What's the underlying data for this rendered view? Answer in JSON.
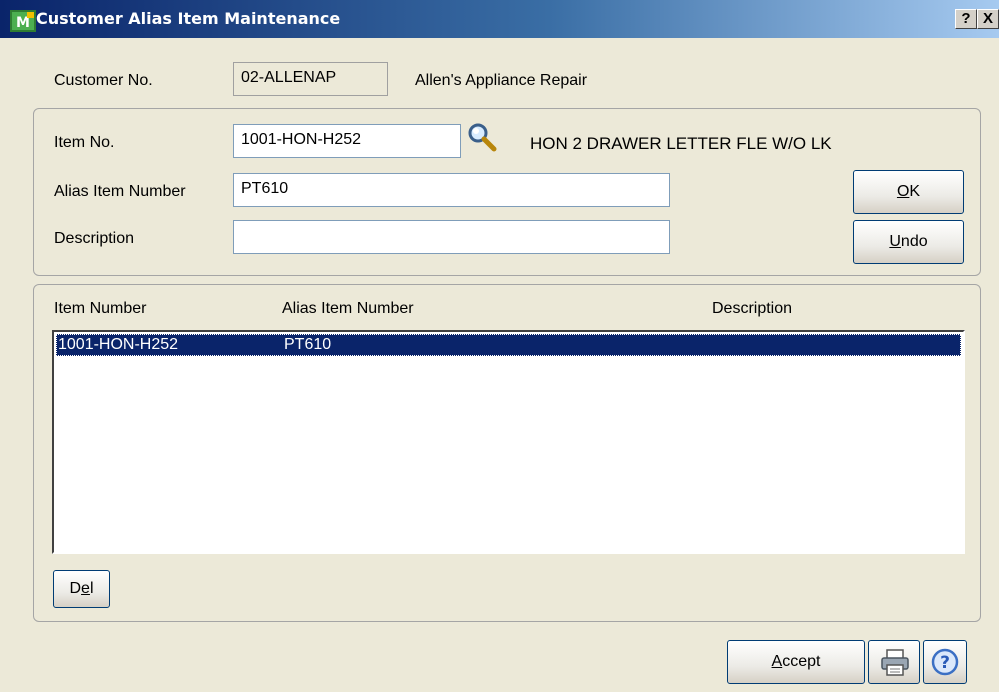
{
  "window": {
    "title": "Customer Alias Item Maintenance",
    "help_glyph": "?",
    "close_glyph": "X"
  },
  "customer": {
    "label": "Customer No.",
    "number": "02-ALLENAP",
    "name": "Allen's Appliance Repair"
  },
  "entry": {
    "item_no_label": "Item No.",
    "item_no_value": "1001-HON-H252",
    "item_description": "HON 2 DRAWER LETTER FLE W/O LK",
    "alias_label": "Alias Item Number",
    "alias_value": "PT610",
    "description_label": "Description",
    "description_value": "",
    "ok_button": {
      "hotkey": "O",
      "rest": "K"
    },
    "undo_button": {
      "hotkey": "U",
      "rest": "ndo"
    }
  },
  "grid": {
    "columns": [
      "Item Number",
      "Alias Item Number",
      "Description"
    ],
    "rows": [
      {
        "item_number": "1001-HON-H252",
        "alias_item_number": "PT610",
        "description": "",
        "selected": true
      }
    ],
    "del_button": {
      "pre": "D",
      "hotkey": "e",
      "rest": "l"
    }
  },
  "footer": {
    "accept_button": {
      "hotkey": "A",
      "rest": "ccept"
    },
    "icons": [
      "printer-icon",
      "help-icon"
    ]
  },
  "colors": {
    "window_bg": "#ece9d8",
    "selection": "#0a246a",
    "titlebar_start": "#0a246a",
    "titlebar_end": "#a6caf0"
  }
}
